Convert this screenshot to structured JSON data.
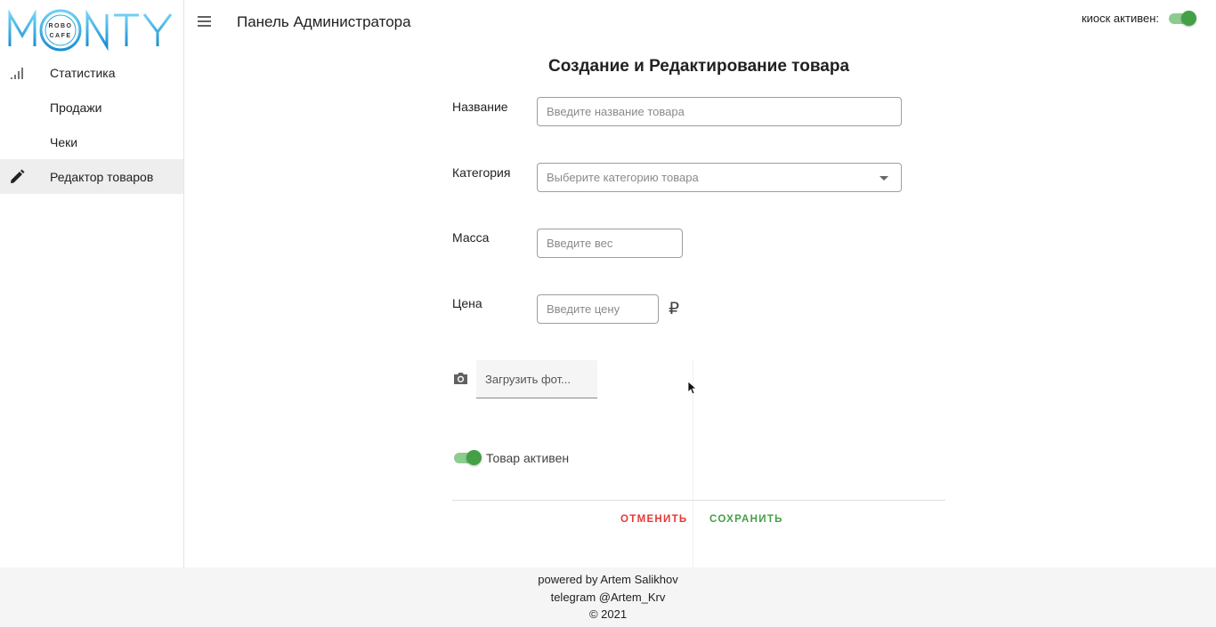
{
  "logo": {
    "brand": "MONTY",
    "badge_top": "ROBO",
    "badge_bottom": "CAFE"
  },
  "sidebar": {
    "items": [
      {
        "label": "Статистика",
        "icon": "bar-chart-icon"
      },
      {
        "label": "Продажи",
        "icon": ""
      },
      {
        "label": "Чеки",
        "icon": ""
      },
      {
        "label": "Редактор товаров",
        "icon": "pencil-icon",
        "active": true
      }
    ]
  },
  "header": {
    "title": "Панель Администратора",
    "kiosk_label": "киоск активен:",
    "kiosk_active": true
  },
  "form": {
    "title": "Создание и Редактирование товара",
    "name_label": "Название",
    "name_placeholder": "Введите название товара",
    "category_label": "Категория",
    "category_placeholder": "Выберите категорию товара",
    "mass_label": "Масса",
    "mass_placeholder": "Введите вес",
    "price_label": "Цена",
    "price_placeholder": "Введите цену",
    "currency": "₽",
    "upload_label": "Загрузить фот...",
    "active_label": "Товар активен",
    "item_active": true,
    "cancel_label": "ОТМЕНИТЬ",
    "save_label": "СОХРАНИТЬ"
  },
  "colors": {
    "accent_green": "#43a047",
    "cancel_red": "#e53935",
    "logo_blue": "#29a8e0"
  },
  "footer": {
    "line1": "powered by Artem Salikhov",
    "line2": "telegram @Artem_Krv",
    "line3": "© 2021"
  }
}
